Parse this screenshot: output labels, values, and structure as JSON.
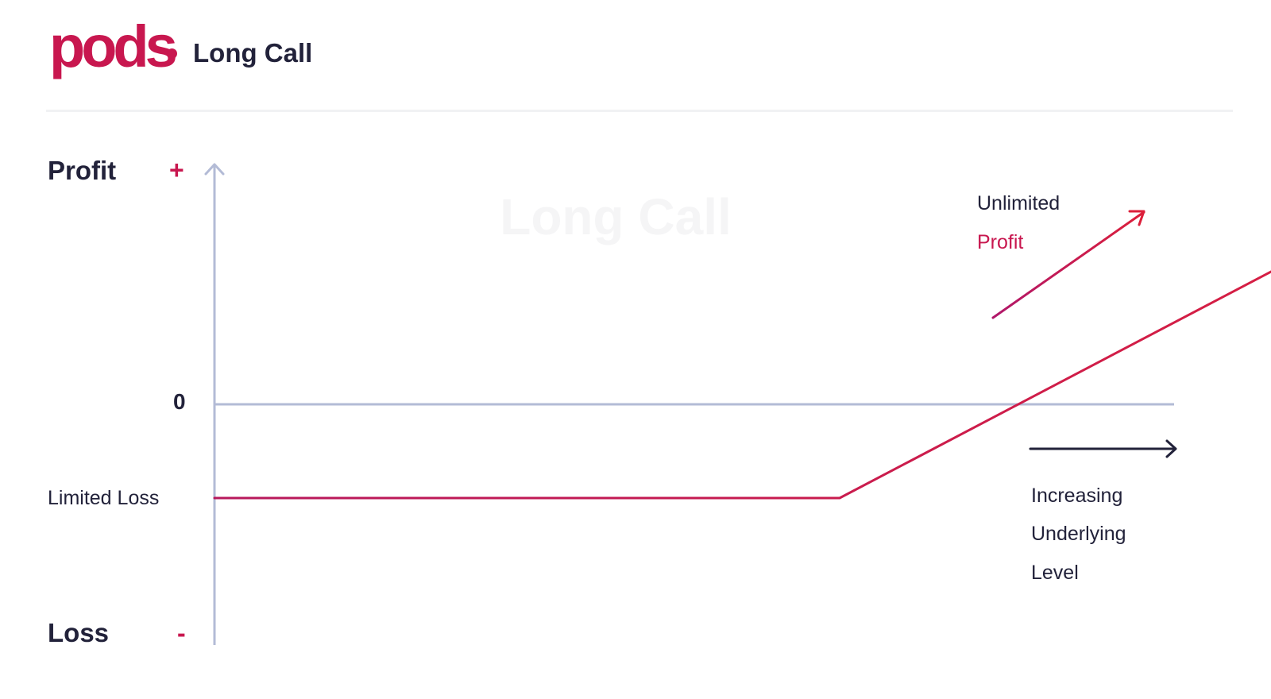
{
  "header": {
    "logo_text": "pods",
    "title": "Long Call"
  },
  "diagram": {
    "watermark": "Long Call",
    "y_axis": {
      "top_label": "Profit",
      "top_sign": "+",
      "bottom_label": "Loss",
      "bottom_sign": "-",
      "zero_label": "0",
      "loss_level_label": "Limited Loss"
    },
    "annotations": {
      "unlimited": "Unlimited",
      "profit": "Profit",
      "x_line1": "Increasing",
      "x_line2": "Underlying",
      "x_line3": "Level"
    }
  },
  "chart_data": {
    "type": "line",
    "title": "Long Call",
    "xlabel": "Increasing Underlying Level",
    "ylabel": "Profit / Loss",
    "series": [
      {
        "values": [
          {
            "x": 0,
            "y": -1
          },
          {
            "x": 1,
            "y": -1
          },
          {
            "x": 2,
            "y": 2.5
          }
        ]
      }
    ]
  },
  "colors": {
    "brand": "#c8174f",
    "payoff": "#c8174f",
    "axis": "#b3bbd6",
    "text": "#22223a",
    "watermark": "#f5f5f6"
  }
}
